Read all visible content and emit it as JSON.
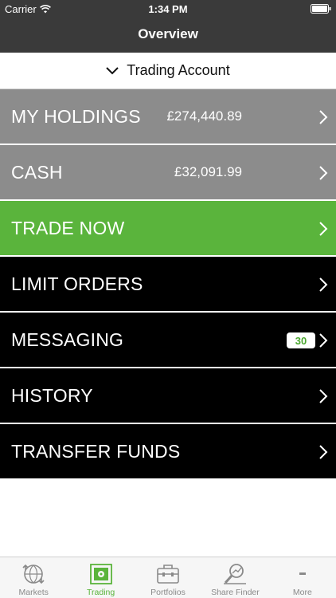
{
  "status_bar": {
    "carrier": "Carrier",
    "time": "1:34 PM"
  },
  "nav": {
    "title": "Overview"
  },
  "account": {
    "label": "Trading Account"
  },
  "menu": {
    "holdings": {
      "label": "MY HOLDINGS",
      "value": "£274,440.89"
    },
    "cash": {
      "label": "CASH",
      "value": "£32,091.99"
    },
    "trade": {
      "label": "TRADE NOW"
    },
    "limit_orders": {
      "label": "LIMIT ORDERS"
    },
    "messaging": {
      "label": "MESSAGING",
      "badge": "30"
    },
    "history": {
      "label": "HISTORY"
    },
    "transfer": {
      "label": "TRANSFER FUNDS"
    }
  },
  "tabs": {
    "markets": {
      "label": "Markets",
      "icon": "markets-icon"
    },
    "trading": {
      "label": "Trading",
      "icon": "trading-icon"
    },
    "portfolios": {
      "label": "Portfolios",
      "icon": "portfolios-icon"
    },
    "share_finder": {
      "label": "Share Finder",
      "icon": "share-finder-icon"
    },
    "more": {
      "label": "More",
      "icon": "more-icon"
    }
  },
  "colors": {
    "header": "#3a3a3a",
    "gray_row": "#8c8c8c",
    "accent_green": "#5ab43c",
    "black_row": "#000000",
    "tab_inactive": "#8a8a8a"
  }
}
